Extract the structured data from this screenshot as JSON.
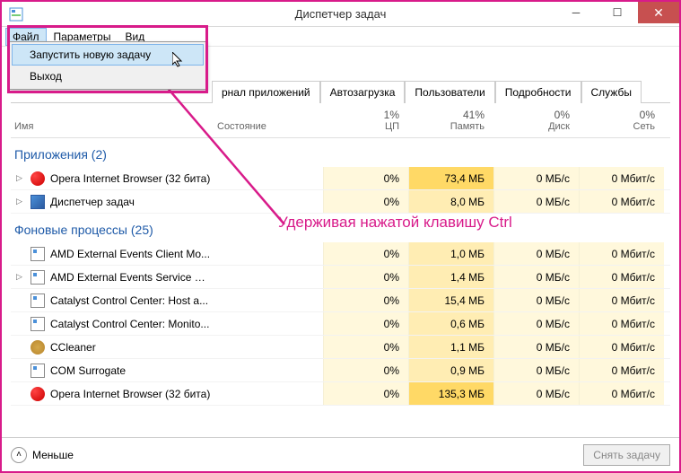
{
  "window": {
    "title": "Диспетчер задач",
    "minimize": "─",
    "maximize": "☐",
    "close": "✕"
  },
  "menubar": {
    "items": [
      "Файл",
      "Параметры",
      "Вид"
    ]
  },
  "dropdown": {
    "new_task": "Запустить новую задачу",
    "exit": "Выход"
  },
  "tabs": {
    "app_history_partial": "рнал приложений",
    "startup": "Автозагрузка",
    "users": "Пользователи",
    "details": "Подробности",
    "services": "Службы"
  },
  "headers": {
    "name": "Имя",
    "state": "Состояние",
    "cpu_pct": "1%",
    "cpu": "ЦП",
    "mem_pct": "41%",
    "mem": "Память",
    "disk_pct": "0%",
    "disk": "Диск",
    "net_pct": "0%",
    "net": "Сеть"
  },
  "groups": {
    "apps": "Приложения (2)",
    "bg": "Фоновые процессы (25)"
  },
  "rows": [
    {
      "icon": "opera",
      "name": "Opera Internet Browser (32 бита)",
      "cpu": "0%",
      "mem": "73,4 МБ",
      "disk": "0 МБ/с",
      "net": "0 Мбит/с",
      "expand": true,
      "hot": true
    },
    {
      "icon": "tm",
      "name": "Диспетчер задач",
      "cpu": "0%",
      "mem": "8,0 МБ",
      "disk": "0 МБ/с",
      "net": "0 Мбит/с",
      "expand": true
    },
    {
      "icon": "gen",
      "name": "AMD External Events Client Mo...",
      "cpu": "0%",
      "mem": "1,0 МБ",
      "disk": "0 МБ/с",
      "net": "0 Мбит/с"
    },
    {
      "icon": "gen",
      "name": "AMD External Events Service Mo...",
      "cpu": "0%",
      "mem": "1,4 МБ",
      "disk": "0 МБ/с",
      "net": "0 Мбит/с",
      "expand": true
    },
    {
      "icon": "gen",
      "name": "Catalyst Control Center: Host a...",
      "cpu": "0%",
      "mem": "15,4 МБ",
      "disk": "0 МБ/с",
      "net": "0 Мбит/с"
    },
    {
      "icon": "gen",
      "name": "Catalyst Control Center: Monito...",
      "cpu": "0%",
      "mem": "0,6 МБ",
      "disk": "0 МБ/с",
      "net": "0 Мбит/с"
    },
    {
      "icon": "cc",
      "name": "CCleaner",
      "cpu": "0%",
      "mem": "1,1 МБ",
      "disk": "0 МБ/с",
      "net": "0 Мбит/с"
    },
    {
      "icon": "gen",
      "name": "COM Surrogate",
      "cpu": "0%",
      "mem": "0,9 МБ",
      "disk": "0 МБ/с",
      "net": "0 Мбит/с"
    },
    {
      "icon": "opera",
      "name": "Opera Internet Browser (32 бита)",
      "cpu": "0%",
      "mem": "135,3 МБ",
      "disk": "0 МБ/с",
      "net": "0 Мбит/с",
      "hot": true
    }
  ],
  "footer": {
    "less": "Меньше",
    "end_task": "Снять задачу"
  },
  "annotation": {
    "text": "Удерживая нажатой клавишу Ctrl"
  }
}
